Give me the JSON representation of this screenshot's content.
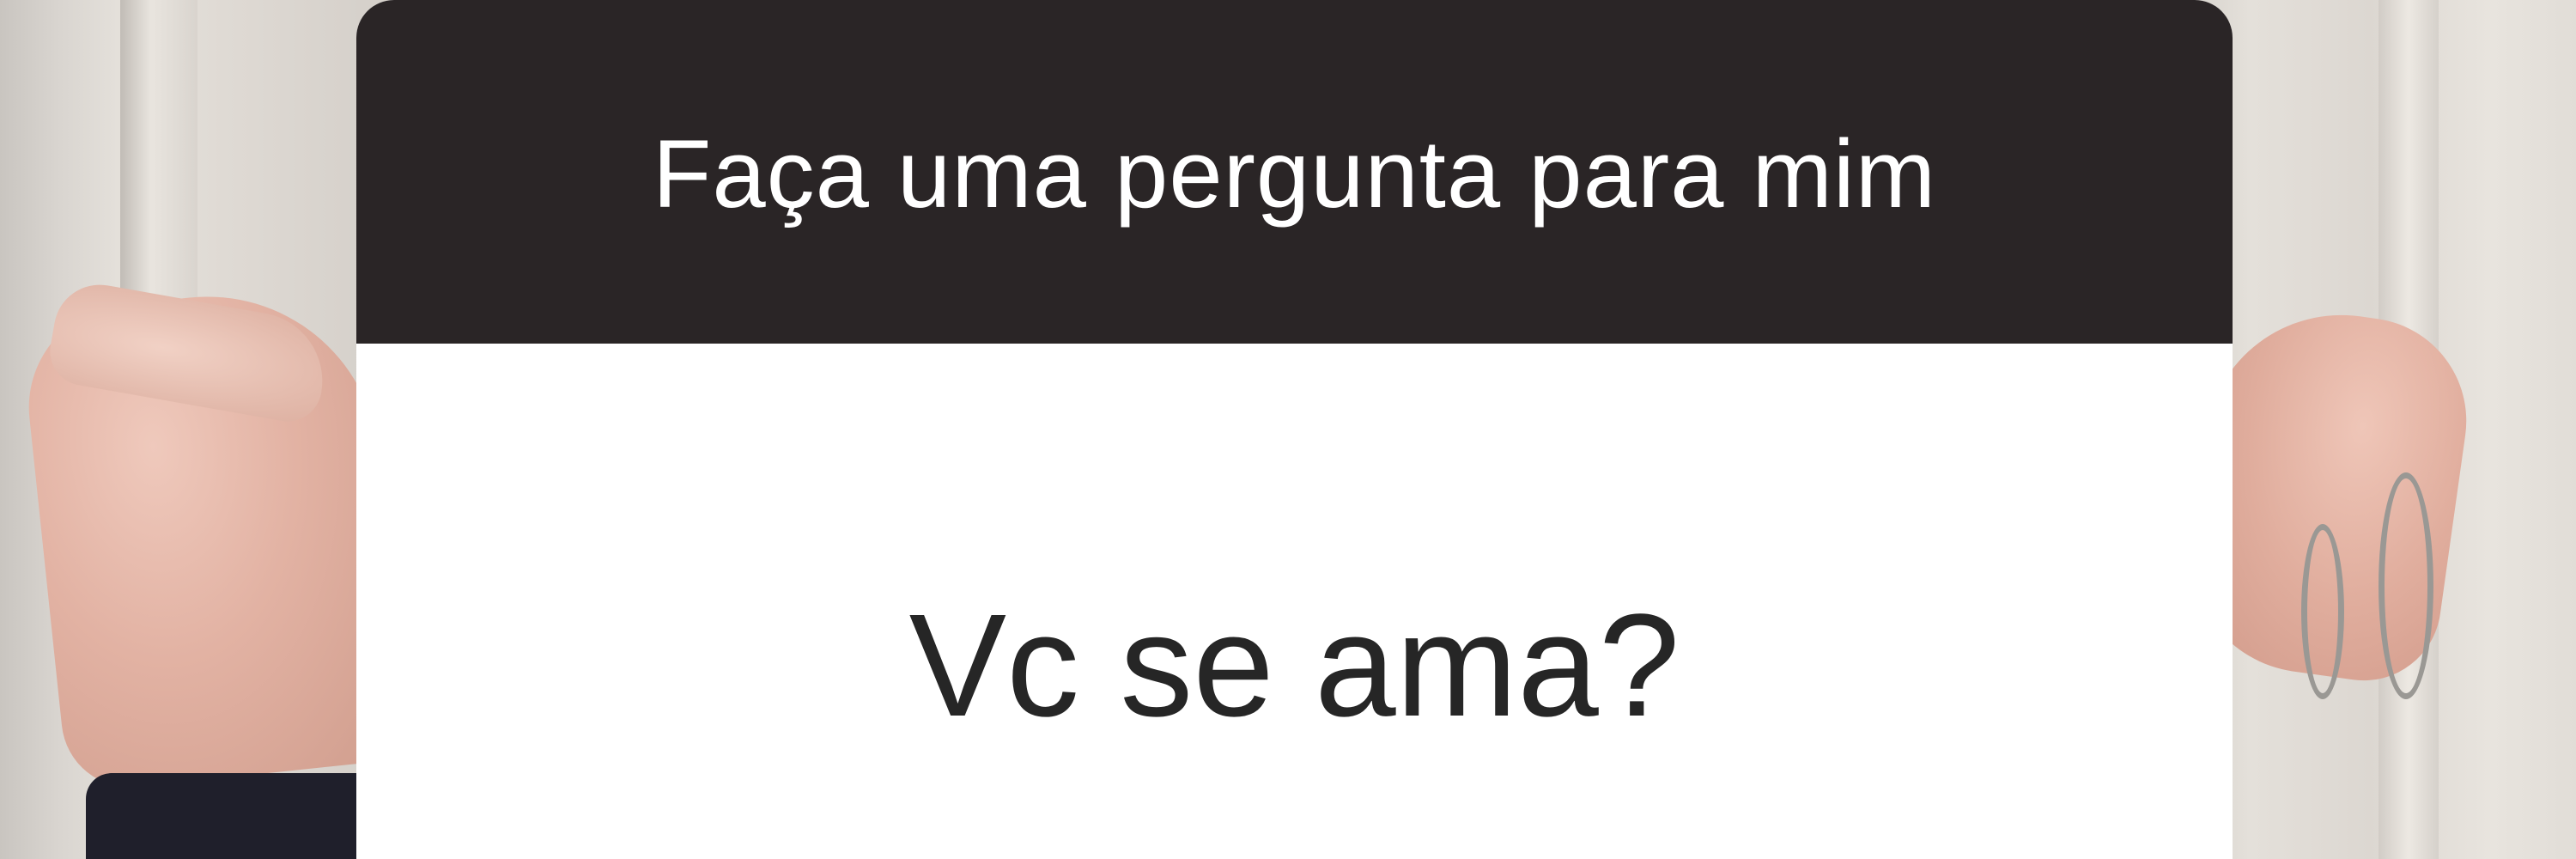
{
  "question_sticker": {
    "prompt": "Faça uma pergunta para mim",
    "question": "Vc se ama?"
  },
  "colors": {
    "header_background": "#2a2526",
    "header_text": "#ffffff",
    "body_background": "#ffffff",
    "question_text": "#262626"
  }
}
